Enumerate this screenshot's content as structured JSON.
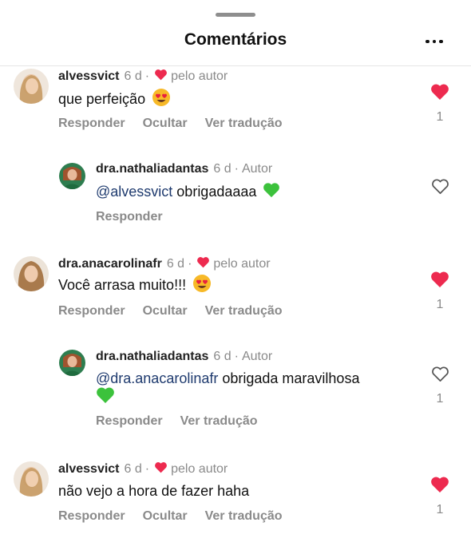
{
  "header": {
    "title": "Comentários"
  },
  "colors": {
    "like_red": "#ed2a4f",
    "green_heart": "#3cc23c",
    "mention": "#1e3a6e",
    "muted": "#8a8a8a"
  },
  "comments": [
    {
      "username": "alvessvict",
      "time": "6 d",
      "liked_by_author_label": "pelo autor",
      "text": "que perfeição",
      "emoji": "heart-eyes-icon",
      "actions": [
        "Responder",
        "Ocultar",
        "Ver tradução"
      ],
      "liked": true,
      "like_count": "1"
    },
    {
      "username": "dra.nathaliadantas",
      "time": "6 d",
      "author_label": "Autor",
      "mention": "@alvessvict",
      "text": "obrigadaaaa",
      "emoji": "green-heart-icon",
      "actions": [
        "Responder"
      ],
      "liked": false
    },
    {
      "username": "dra.anacarolinafr",
      "time": "6 d",
      "liked_by_author_label": "pelo autor",
      "text": "Você arrasa muito!!!",
      "emoji": "heart-eyes-icon",
      "actions": [
        "Responder",
        "Ocultar",
        "Ver tradução"
      ],
      "liked": true,
      "like_count": "1"
    },
    {
      "username": "dra.nathaliadantas",
      "time": "6 d",
      "author_label": "Autor",
      "mention": "@dra.anacarolinafr",
      "text": "obrigada maravilhosa",
      "emoji": "green-heart-icon",
      "actions": [
        "Responder",
        "Ver tradução"
      ],
      "liked": false,
      "like_count": "1"
    },
    {
      "username": "alvessvict",
      "time": "6 d",
      "liked_by_author_label": "pelo autor",
      "text": "não vejo a hora de fazer haha",
      "actions": [
        "Responder",
        "Ocultar",
        "Ver tradução"
      ],
      "liked": true,
      "like_count": "1"
    }
  ]
}
